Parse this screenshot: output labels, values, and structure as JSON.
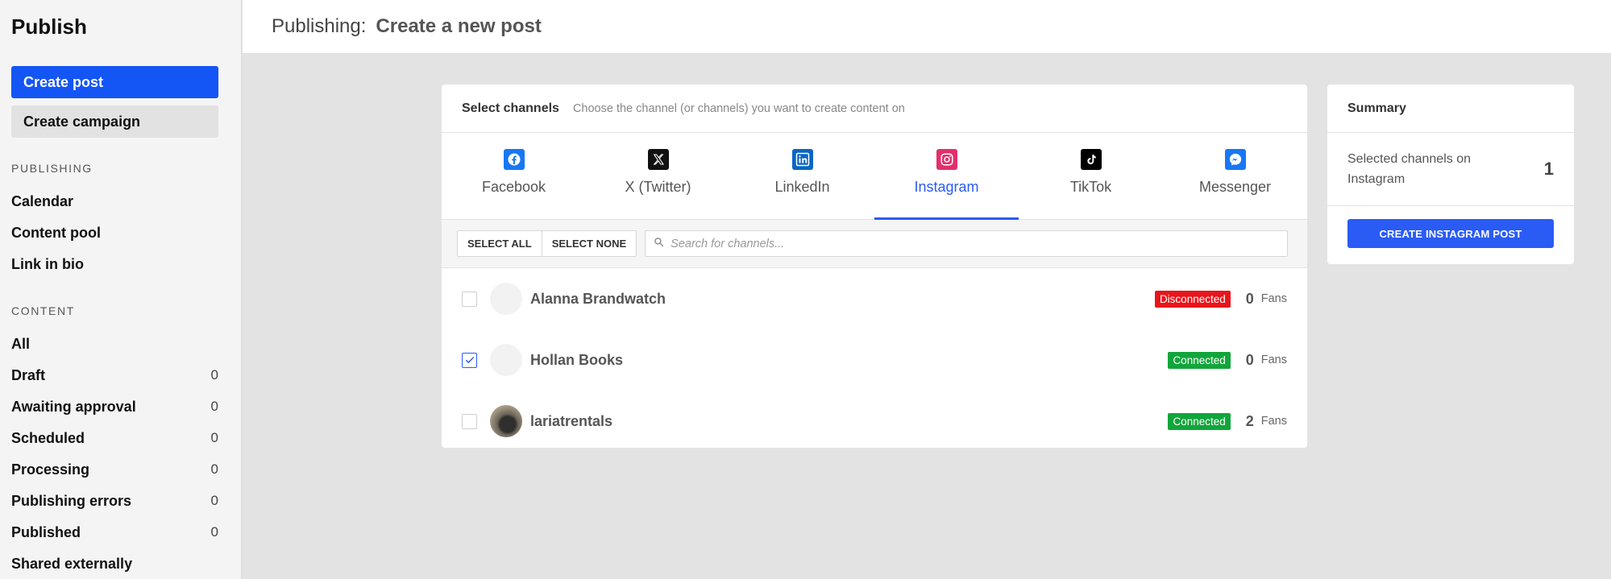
{
  "sidebar": {
    "app_title": "Publish",
    "create_post_label": "Create post",
    "create_campaign_label": "Create campaign",
    "publishing_heading": "PUBLISHING",
    "publishing_items": [
      {
        "label": "Calendar"
      },
      {
        "label": "Content pool"
      },
      {
        "label": "Link in bio"
      }
    ],
    "content_heading": "CONTENT",
    "content_items": [
      {
        "label": "All",
        "count": ""
      },
      {
        "label": "Draft",
        "count": "0"
      },
      {
        "label": "Awaiting approval",
        "count": "0"
      },
      {
        "label": "Scheduled",
        "count": "0"
      },
      {
        "label": "Processing",
        "count": "0"
      },
      {
        "label": "Publishing errors",
        "count": "0"
      },
      {
        "label": "Published",
        "count": "0"
      },
      {
        "label": "Shared externally",
        "count": ""
      }
    ]
  },
  "header": {
    "prefix": "Publishing:",
    "title": "Create a new post"
  },
  "channels": {
    "label": "Select channels",
    "hint": "Choose the channel (or channels) you want to create content on",
    "tabs": [
      {
        "label": "Facebook",
        "icon": "facebook-icon",
        "color": "#1877f2"
      },
      {
        "label": "X (Twitter)",
        "icon": "x-twitter-icon",
        "color": "#111111"
      },
      {
        "label": "LinkedIn",
        "icon": "linkedin-icon",
        "color": "#0a66c2"
      },
      {
        "label": "Instagram",
        "icon": "instagram-icon",
        "color": "#e1306c",
        "active": true
      },
      {
        "label": "TikTok",
        "icon": "tiktok-icon",
        "color": "#000000"
      },
      {
        "label": "Messenger",
        "icon": "messenger-icon",
        "color": "#1877f2"
      }
    ],
    "select_all_label": "SELECT ALL",
    "select_none_label": "SELECT NONE",
    "search_placeholder": "Search for channels...",
    "rows": [
      {
        "name": "Alanna Brandwatch",
        "status": "Disconnected",
        "fans": "0",
        "fans_label": "Fans",
        "checked": false
      },
      {
        "name": "Hollan Books",
        "status": "Connected",
        "fans": "0",
        "fans_label": "Fans",
        "checked": true
      },
      {
        "name": "lariatrentals",
        "status": "Connected",
        "fans": "2",
        "fans_label": "Fans",
        "checked": false
      }
    ]
  },
  "summary": {
    "title": "Summary",
    "selected_text": "Selected channels on Instagram",
    "selected_count": "1",
    "button_label": "CREATE INSTAGRAM POST"
  },
  "colors": {
    "primary": "#1455f6",
    "accent": "#2a5bf5",
    "disconnected": "#e8151b",
    "connected": "#12a53b"
  }
}
